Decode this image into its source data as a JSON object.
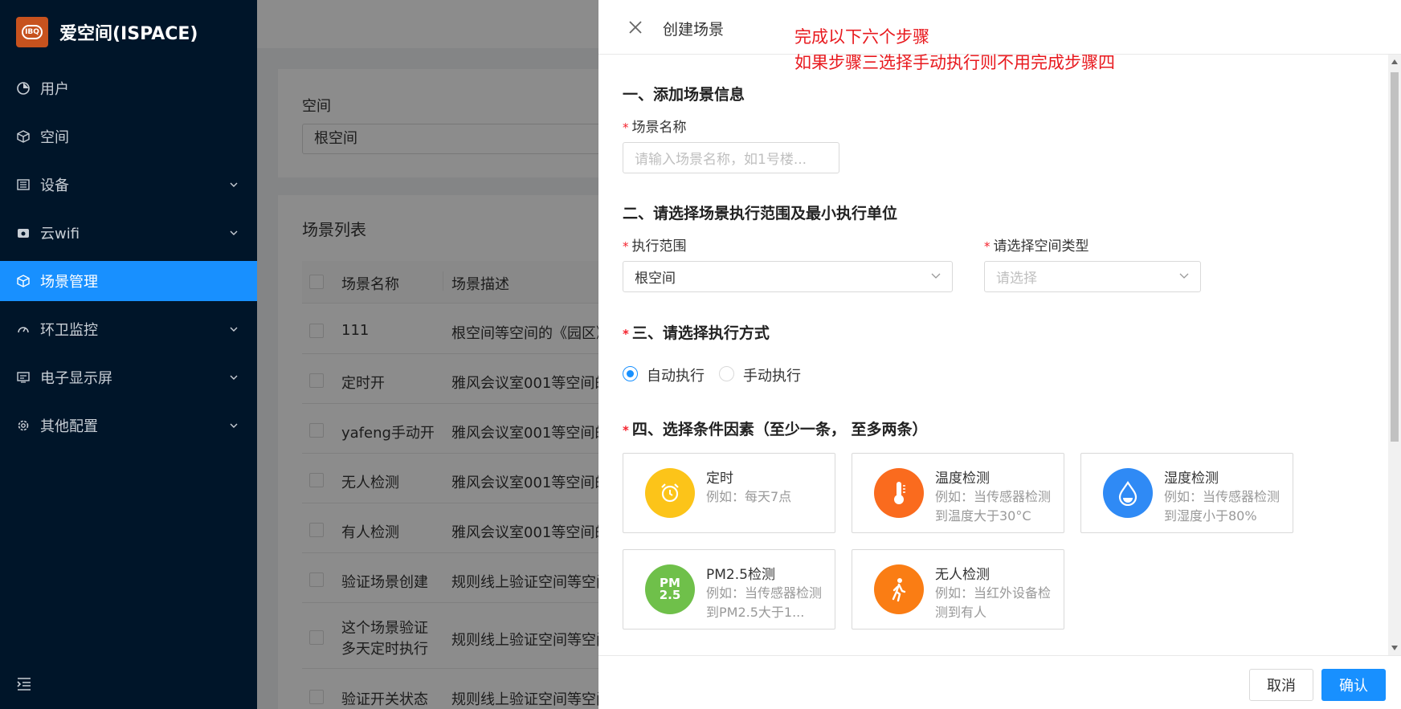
{
  "app": {
    "name": "爱空间(ISPACE)",
    "logo_text": "IBQ"
  },
  "sidebar": {
    "items": [
      {
        "label": "用户",
        "icon": "pie-icon",
        "active": false,
        "expandable": false
      },
      {
        "label": "空间",
        "icon": "cube-icon",
        "active": false,
        "expandable": false
      },
      {
        "label": "设备",
        "icon": "device-icon",
        "active": false,
        "expandable": true
      },
      {
        "label": "云wifi",
        "icon": "wifi-icon",
        "active": false,
        "expandable": true
      },
      {
        "label": "场景管理",
        "icon": "cube-icon",
        "active": true,
        "expandable": false
      },
      {
        "label": "环卫监控",
        "icon": "gauge-icon",
        "active": false,
        "expandable": true
      },
      {
        "label": "电子显示屏",
        "icon": "screen-icon",
        "active": false,
        "expandable": true
      },
      {
        "label": "其他配置",
        "icon": "gear-icon",
        "active": false,
        "expandable": true
      }
    ]
  },
  "background": {
    "filter_label": "空间",
    "filter_value": "根空间",
    "list_title": "场景列表",
    "table": {
      "headers": [
        "场景名称",
        "场景描述"
      ],
      "rows": [
        [
          "111",
          "根空间等空间的《园区》"
        ],
        [
          "定时开",
          "雅风会议室001等空间的"
        ],
        [
          "yafeng手动开",
          "雅风会议室001等空间的"
        ],
        [
          "无人检测",
          "雅风会议室001等空间的"
        ],
        [
          "有人检测",
          "雅风会议室001等空间的"
        ],
        [
          "验证场景创建",
          "规则线上验证空间等空间"
        ],
        [
          "这个场景验证\n多天定时执行",
          "规则线上验证空间等空间"
        ],
        [
          "验证开关状态",
          "规则线上验证空间等空间"
        ]
      ]
    }
  },
  "drawer": {
    "title": "创建场景",
    "note_line1": "完成以下六个步骤",
    "note_line2": "如果步骤三选择手动执行则不用完成步骤四",
    "section1": {
      "title": "一、添加场景信息",
      "name_label": "场景名称",
      "name_placeholder": "请输入场景名称，如1号楼..."
    },
    "section2": {
      "title": "二、请选择场景执行范围及最小执行单位",
      "scope_label": "执行范围",
      "scope_value": "根空间",
      "type_label": "请选择空间类型",
      "type_placeholder": "请选择"
    },
    "section3": {
      "title": "三、请选择执行方式",
      "option_auto": "自动执行",
      "option_manual": "手动执行",
      "selected": "自动执行"
    },
    "section4": {
      "title": "四、选择条件因素（至少一条， 至多两条）",
      "cards": [
        {
          "title": "定时",
          "desc": "例如：每天7点",
          "icon": "alarm-clock-icon",
          "color": "#fcc419"
        },
        {
          "title": "温度检测",
          "desc": "例如：当传感器检测到温度大于30°C",
          "icon": "thermometer-icon",
          "color": "#fa6b1e"
        },
        {
          "title": "湿度检测",
          "desc": "例如：当传感器检测到湿度小于80%",
          "icon": "water-drop-icon",
          "color": "#2f8af5"
        },
        {
          "title": "PM2.5检测",
          "desc": "例如：当传感器检测到PM2.5大于1...",
          "icon": "pm25-icon",
          "icon_text": "PM 2.5",
          "color": "#6fc04a"
        },
        {
          "title": "无人检测",
          "desc": "例如：当红外设备检测到有人",
          "icon": "walking-person-icon",
          "color": "#fa7d14"
        }
      ]
    },
    "footer": {
      "cancel": "取消",
      "confirm": "确认"
    }
  }
}
